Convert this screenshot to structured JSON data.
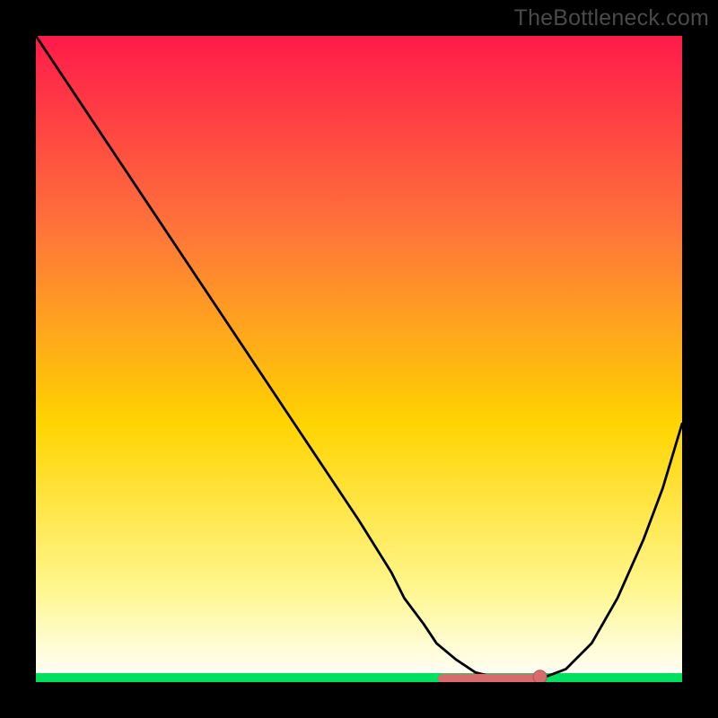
{
  "attribution": "TheBottleneck.com",
  "colors": {
    "background": "#000000",
    "gradient_top": "#ff1a4a",
    "gradient_mid_upper": "#ff743a",
    "gradient_mid": "#ffd400",
    "gradient_mid_lower": "#fff68a",
    "gradient_bottom": "#ffffff",
    "baseline": "#00e060",
    "curve": "#000000",
    "marker_fill": "#d86b6b",
    "marker_stroke": "#b85050",
    "attribution_text": "#4a4a4a"
  },
  "chart_data": {
    "type": "line",
    "title": "",
    "xlabel": "",
    "ylabel": "",
    "xlim": [
      0,
      100
    ],
    "ylim": [
      0,
      100
    ],
    "x": [
      0,
      2,
      5,
      10,
      15,
      20,
      25,
      30,
      35,
      40,
      45,
      50,
      55,
      57,
      60,
      62,
      65,
      68,
      72,
      75,
      78,
      82,
      86,
      90,
      94,
      97,
      100
    ],
    "y": [
      100,
      97,
      92.5,
      85,
      77.5,
      70,
      62.5,
      55,
      47.5,
      40,
      32.5,
      25,
      17,
      13,
      9,
      6,
      3.5,
      1.5,
      0.5,
      0.3,
      0.5,
      2,
      6,
      13,
      22,
      30,
      40
    ],
    "flat_region": {
      "x_start": 63,
      "x_end": 78,
      "y": 0.5
    },
    "marker": {
      "x": 78,
      "y": 0.8
    },
    "description": "V-shaped bottleneck curve: steep descent from top-left toward a minimum near x≈70-78, broad flat bottom, then rising toward the right edge."
  }
}
